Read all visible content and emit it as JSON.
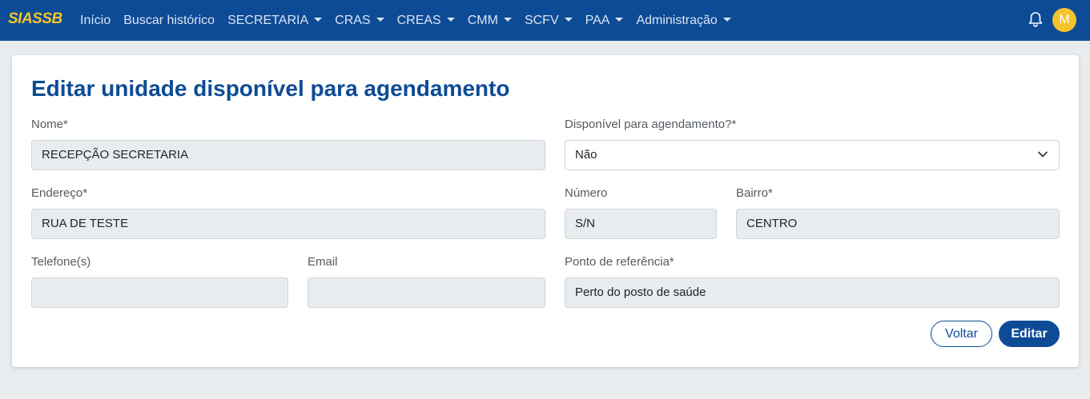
{
  "navbar": {
    "brand": "SIASSB",
    "items": [
      {
        "label": "Início",
        "dropdown": false
      },
      {
        "label": "Buscar histórico",
        "dropdown": false
      },
      {
        "label": "SECRETARIA",
        "dropdown": true
      },
      {
        "label": "CRAS",
        "dropdown": true
      },
      {
        "label": "CREAS",
        "dropdown": true
      },
      {
        "label": "CMM",
        "dropdown": true
      },
      {
        "label": "SCFV",
        "dropdown": true
      },
      {
        "label": "PAA",
        "dropdown": true
      },
      {
        "label": "Administração",
        "dropdown": true
      }
    ],
    "notification_icon": "bell-icon",
    "avatar_initial": "M"
  },
  "form": {
    "title": "Editar unidade disponível para agendamento",
    "nome": {
      "label": "Nome*",
      "value": "RECEPÇÃO SECRETARIA"
    },
    "disponivel": {
      "label": "Disponível para agendamento?*",
      "value": "Não"
    },
    "endereco": {
      "label": "Endereço*",
      "value": "RUA DE TESTE"
    },
    "numero": {
      "label": "Número",
      "value": "S/N"
    },
    "bairro": {
      "label": "Bairro*",
      "value": "CENTRO"
    },
    "telefone": {
      "label": "Telefone(s)",
      "value": ""
    },
    "email": {
      "label": "Email",
      "value": ""
    },
    "ponto_referencia": {
      "label": "Ponto de referência*",
      "value": "Perto do posto de saúde"
    }
  },
  "actions": {
    "back_label": "Voltar",
    "edit_label": "Editar"
  },
  "colors": {
    "primary": "#0d4b96",
    "brand_accent": "#f5c32c",
    "page_background": "#e9ecef"
  }
}
